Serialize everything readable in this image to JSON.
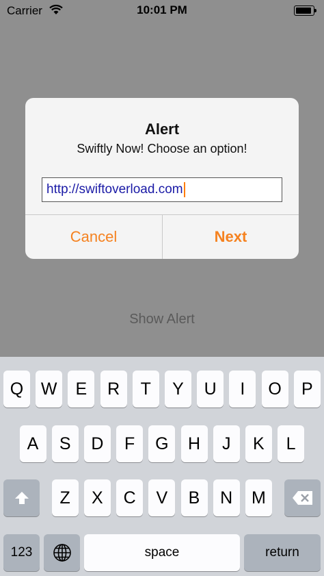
{
  "status_bar": {
    "carrier": "Carrier",
    "time": "10:01 PM",
    "battery_level": 0.9
  },
  "background": {
    "show_alert_label": "Show Alert"
  },
  "alert": {
    "title": "Alert",
    "message": "Swiftly Now! Choose an option!",
    "text_field_value": "http://swiftoverload.com",
    "cancel_label": "Cancel",
    "next_label": "Next",
    "accent_color": "#f58220"
  },
  "keyboard": {
    "row1": [
      "Q",
      "W",
      "E",
      "R",
      "T",
      "Y",
      "U",
      "I",
      "O",
      "P"
    ],
    "row2": [
      "A",
      "S",
      "D",
      "F",
      "G",
      "H",
      "J",
      "K",
      "L"
    ],
    "row3": [
      "Z",
      "X",
      "C",
      "V",
      "B",
      "N",
      "M"
    ],
    "numbers_label": "123",
    "space_label": "space",
    "return_label": "return",
    "shift_icon": "shift-icon",
    "delete_icon": "delete-icon",
    "globe_icon": "globe-icon"
  }
}
